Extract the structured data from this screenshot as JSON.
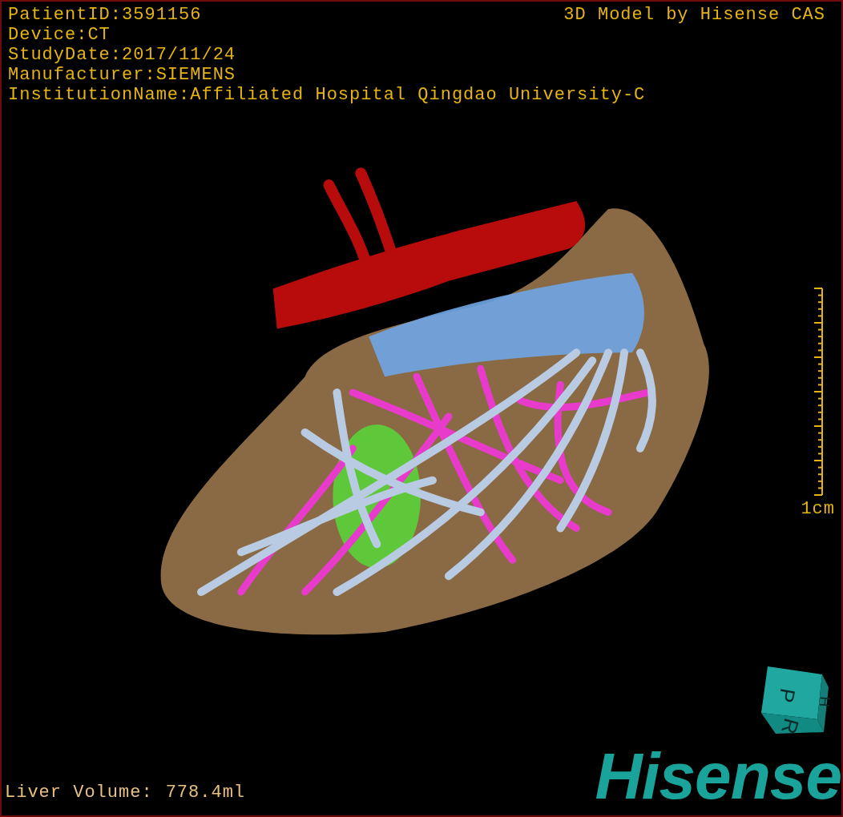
{
  "info_lines": [
    "PatientID:3591156",
    "Device:CT",
    "StudyDate:2017/11/24",
    "Manufacturer:SIEMENS",
    "InstitutionName:Affiliated Hospital Qingdao University-C"
  ],
  "title": "3D Model by Hisense CAS",
  "scale_bar": {
    "label": "1cm"
  },
  "orientation_cube": {
    "faces": [
      "P",
      "H",
      "R"
    ]
  },
  "logo": "Hisense",
  "liver_volume": {
    "label": "Liver Volume:",
    "value": "778.4ml"
  }
}
